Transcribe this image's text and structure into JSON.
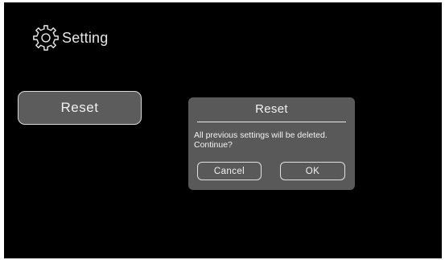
{
  "header": {
    "icon": "gear-icon",
    "title": "Setting"
  },
  "main": {
    "reset_label": "Reset"
  },
  "dialog": {
    "title": "Reset",
    "message_line1": "All previous settings will be deleted.",
    "message_line2": "Continue?",
    "cancel_label": "Cancel",
    "ok_label": "OK"
  },
  "colors": {
    "background": "#000000",
    "button_fill": "#5c5c5c",
    "dialog_fill": "#595959",
    "border": "#d8d8d8",
    "text": "#f0f0f0"
  }
}
